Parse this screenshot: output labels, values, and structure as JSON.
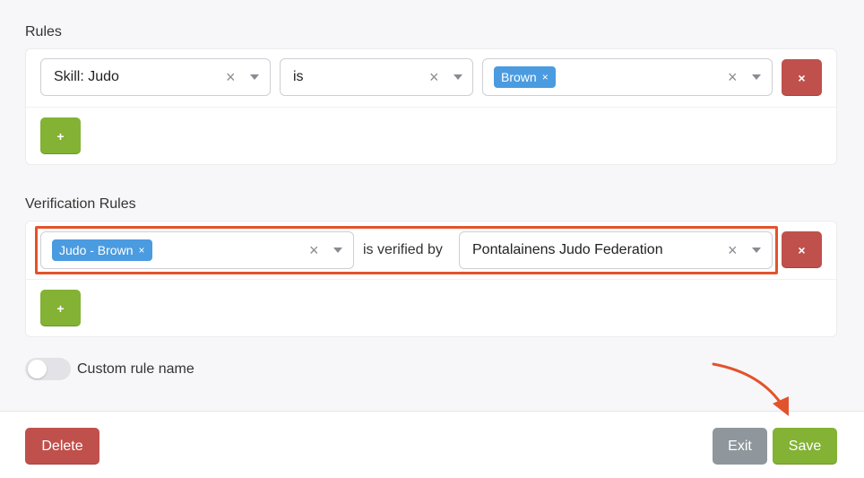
{
  "rules": {
    "heading": "Rules",
    "row": {
      "field": "Skill: Judo",
      "operator": "is",
      "values": [
        "Brown"
      ],
      "clear_symbol": "×",
      "tag_remove_symbol": "×",
      "remove_label": "×"
    },
    "add_label": "+"
  },
  "verification": {
    "heading": "Verification Rules",
    "row": {
      "skills": [
        "Judo - Brown"
      ],
      "connector": "is verified by",
      "verifier": "Pontalainens Judo Federation",
      "clear_symbol": "×",
      "tag_remove_symbol": "×",
      "remove_label": "×"
    },
    "add_label": "+"
  },
  "custom_name": {
    "label": "Custom rule name",
    "enabled": false
  },
  "footer": {
    "delete_label": "Delete",
    "exit_label": "Exit",
    "save_label": "Save"
  },
  "colors": {
    "danger": "#c0504c",
    "success": "#83b235",
    "secondary": "#8f979c",
    "tag": "#4a9be0",
    "annotation": "#e2532c"
  },
  "icons": [
    "clear-icon",
    "caret-down-icon",
    "tag-remove-icon",
    "annotation-arrow-icon"
  ]
}
